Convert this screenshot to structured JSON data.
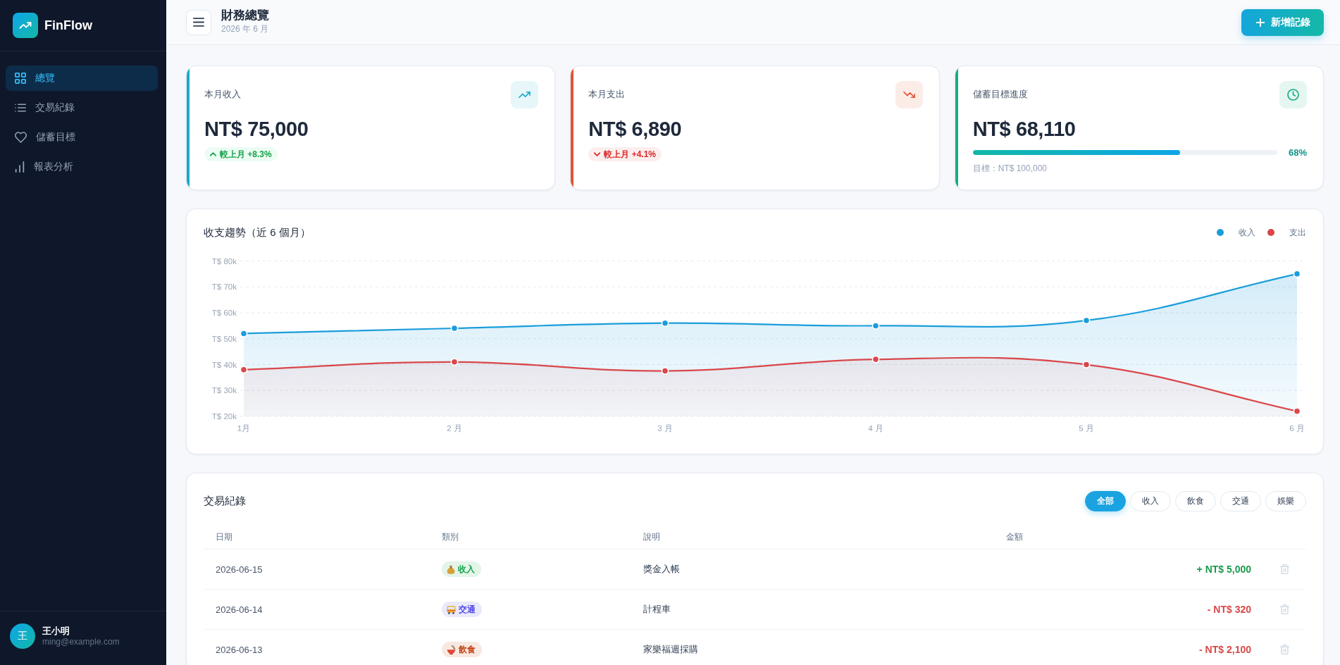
{
  "sidebar": {
    "logo": {
      "text": "FinFlow"
    },
    "items": [
      {
        "label": "總覽",
        "selected": true
      },
      {
        "label": "交易紀錄",
        "selected": false
      },
      {
        "label": "儲蓄目標",
        "selected": false
      },
      {
        "label": "報表分析",
        "selected": false
      }
    ],
    "user": {
      "avatar": "王",
      "name": "王小明",
      "email": "ming@example.com"
    }
  },
  "header": {
    "title": "財務總覽",
    "subtitle": "2026 年 6 月",
    "add_button": "新增記錄"
  },
  "cards": [
    {
      "kind": "income",
      "label": "本月收入",
      "value": "NT$ 75,000",
      "color": "#17aacb",
      "change": "較上月 +8.3%"
    },
    {
      "kind": "expense",
      "label": "本月支出",
      "value": "NT$ 6,890",
      "color": "#e2532f",
      "change": "較上月 +4.1%"
    },
    {
      "kind": "goal",
      "label": "儲蓄目標進度",
      "value": "NT$ 68,110",
      "color": "#14ad84",
      "progress": {
        "level": 0.68,
        "percent": "68%",
        "target": "目標：NT$ 100,000"
      }
    }
  ],
  "trend_chart": {
    "title": "收支趨勢（近 6 個月）",
    "legend": [
      {
        "name": "收入",
        "color": "#1b9ddb"
      },
      {
        "name": "支出",
        "color": "#d9474b"
      }
    ],
    "y_axis_labels": [
      "T$ 80k",
      "T$ 70k",
      "T$ 60k",
      "T$ 50k",
      "T$ 40k",
      "T$ 30k",
      "T$ 20k"
    ],
    "x_axis_labels": [
      "1月",
      "2 月",
      "3 月",
      "4 月",
      "5 月",
      "6 月"
    ]
  },
  "transactions": {
    "title": "交易紀錄",
    "filters": [
      {
        "label": "全部",
        "selected": true
      },
      {
        "label": "收入",
        "selected": false
      },
      {
        "label": "飲食",
        "selected": false
      },
      {
        "label": "交通",
        "selected": false
      },
      {
        "label": "娛樂",
        "selected": false
      }
    ],
    "columns": [
      "日期",
      "類別",
      "說明",
      "金額"
    ],
    "rows": [
      {
        "date": "2026-06-15",
        "category": {
          "kind": "income",
          "label": "收入",
          "color": "#16a34a"
        },
        "description": "獎金入帳",
        "amount": "+ NT$ 5,000",
        "kind": "income"
      },
      {
        "date": "2026-06-14",
        "category": {
          "kind": "transport",
          "label": "交通",
          "color": "#4f46e5"
        },
        "description": "計程車",
        "amount": "- NT$ 320",
        "kind": "expense"
      },
      {
        "date": "2026-06-13",
        "category": {
          "kind": "food",
          "label": "飲食",
          "color": "#c2410c"
        },
        "description": "家樂福週採購",
        "amount": "- NT$ 2,100",
        "kind": "expense"
      }
    ]
  }
}
